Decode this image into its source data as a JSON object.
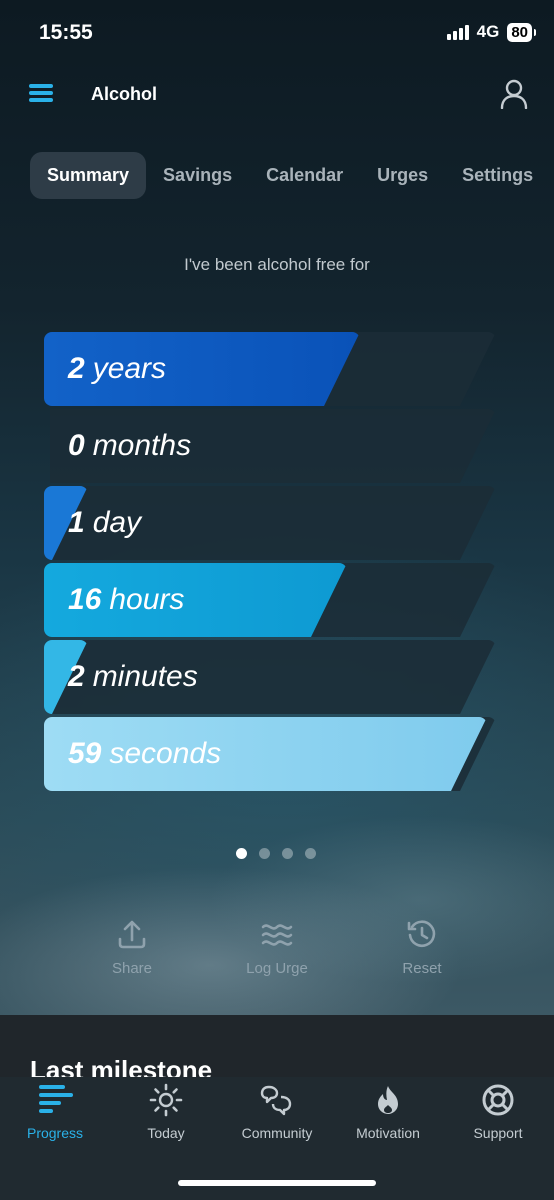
{
  "status": {
    "time": "15:55",
    "network": "4G",
    "battery": "80"
  },
  "header": {
    "title": "Alcohol"
  },
  "tabs": [
    {
      "label": "Summary",
      "active": true
    },
    {
      "label": "Savings",
      "active": false
    },
    {
      "label": "Calendar",
      "active": false
    },
    {
      "label": "Urges",
      "active": false
    },
    {
      "label": "Settings",
      "active": false
    }
  ],
  "intro_text": "I've been alcohol free for",
  "counters": [
    {
      "value": "2",
      "unit": "years",
      "fill": 0.7,
      "color_a": "#1262c8",
      "color_b": "#0a52b8"
    },
    {
      "value": "0",
      "unit": "months",
      "fill": 0.0,
      "color_a": "#1a6fd0",
      "color_b": "#1a6fd0"
    },
    {
      "value": "1",
      "unit": "day",
      "fill": 0.03,
      "color_a": "#1a78d6",
      "color_b": "#1a78d6"
    },
    {
      "value": "16",
      "unit": "hours",
      "fill": 0.67,
      "color_a": "#14a9de",
      "color_b": "#0e9ad2"
    },
    {
      "value": "2",
      "unit": "minutes",
      "fill": 0.03,
      "color_a": "#33b7e6",
      "color_b": "#33b7e6"
    },
    {
      "value": "59",
      "unit": "seconds",
      "fill": 0.98,
      "color_a": "#9edcf4",
      "color_b": "#7fcbed"
    }
  ],
  "pager": {
    "count": 4,
    "active": 0
  },
  "actions": [
    {
      "label": "Share",
      "icon": "share-icon"
    },
    {
      "label": "Log Urge",
      "icon": "waves-icon"
    },
    {
      "label": "Reset",
      "icon": "history-icon"
    }
  ],
  "milestone": {
    "title": "Last milestone"
  },
  "nav": [
    {
      "label": "Progress",
      "icon": "progress-icon",
      "active": true
    },
    {
      "label": "Today",
      "icon": "sun-icon",
      "active": false
    },
    {
      "label": "Community",
      "icon": "community-icon",
      "active": false
    },
    {
      "label": "Motivation",
      "icon": "flame-icon",
      "active": false
    },
    {
      "label": "Support",
      "icon": "lifebuoy-icon",
      "active": false
    }
  ],
  "colors": {
    "accent": "#2ab1e8",
    "tab_active_bg": "#34424c",
    "nav_bg": "#202a30"
  }
}
